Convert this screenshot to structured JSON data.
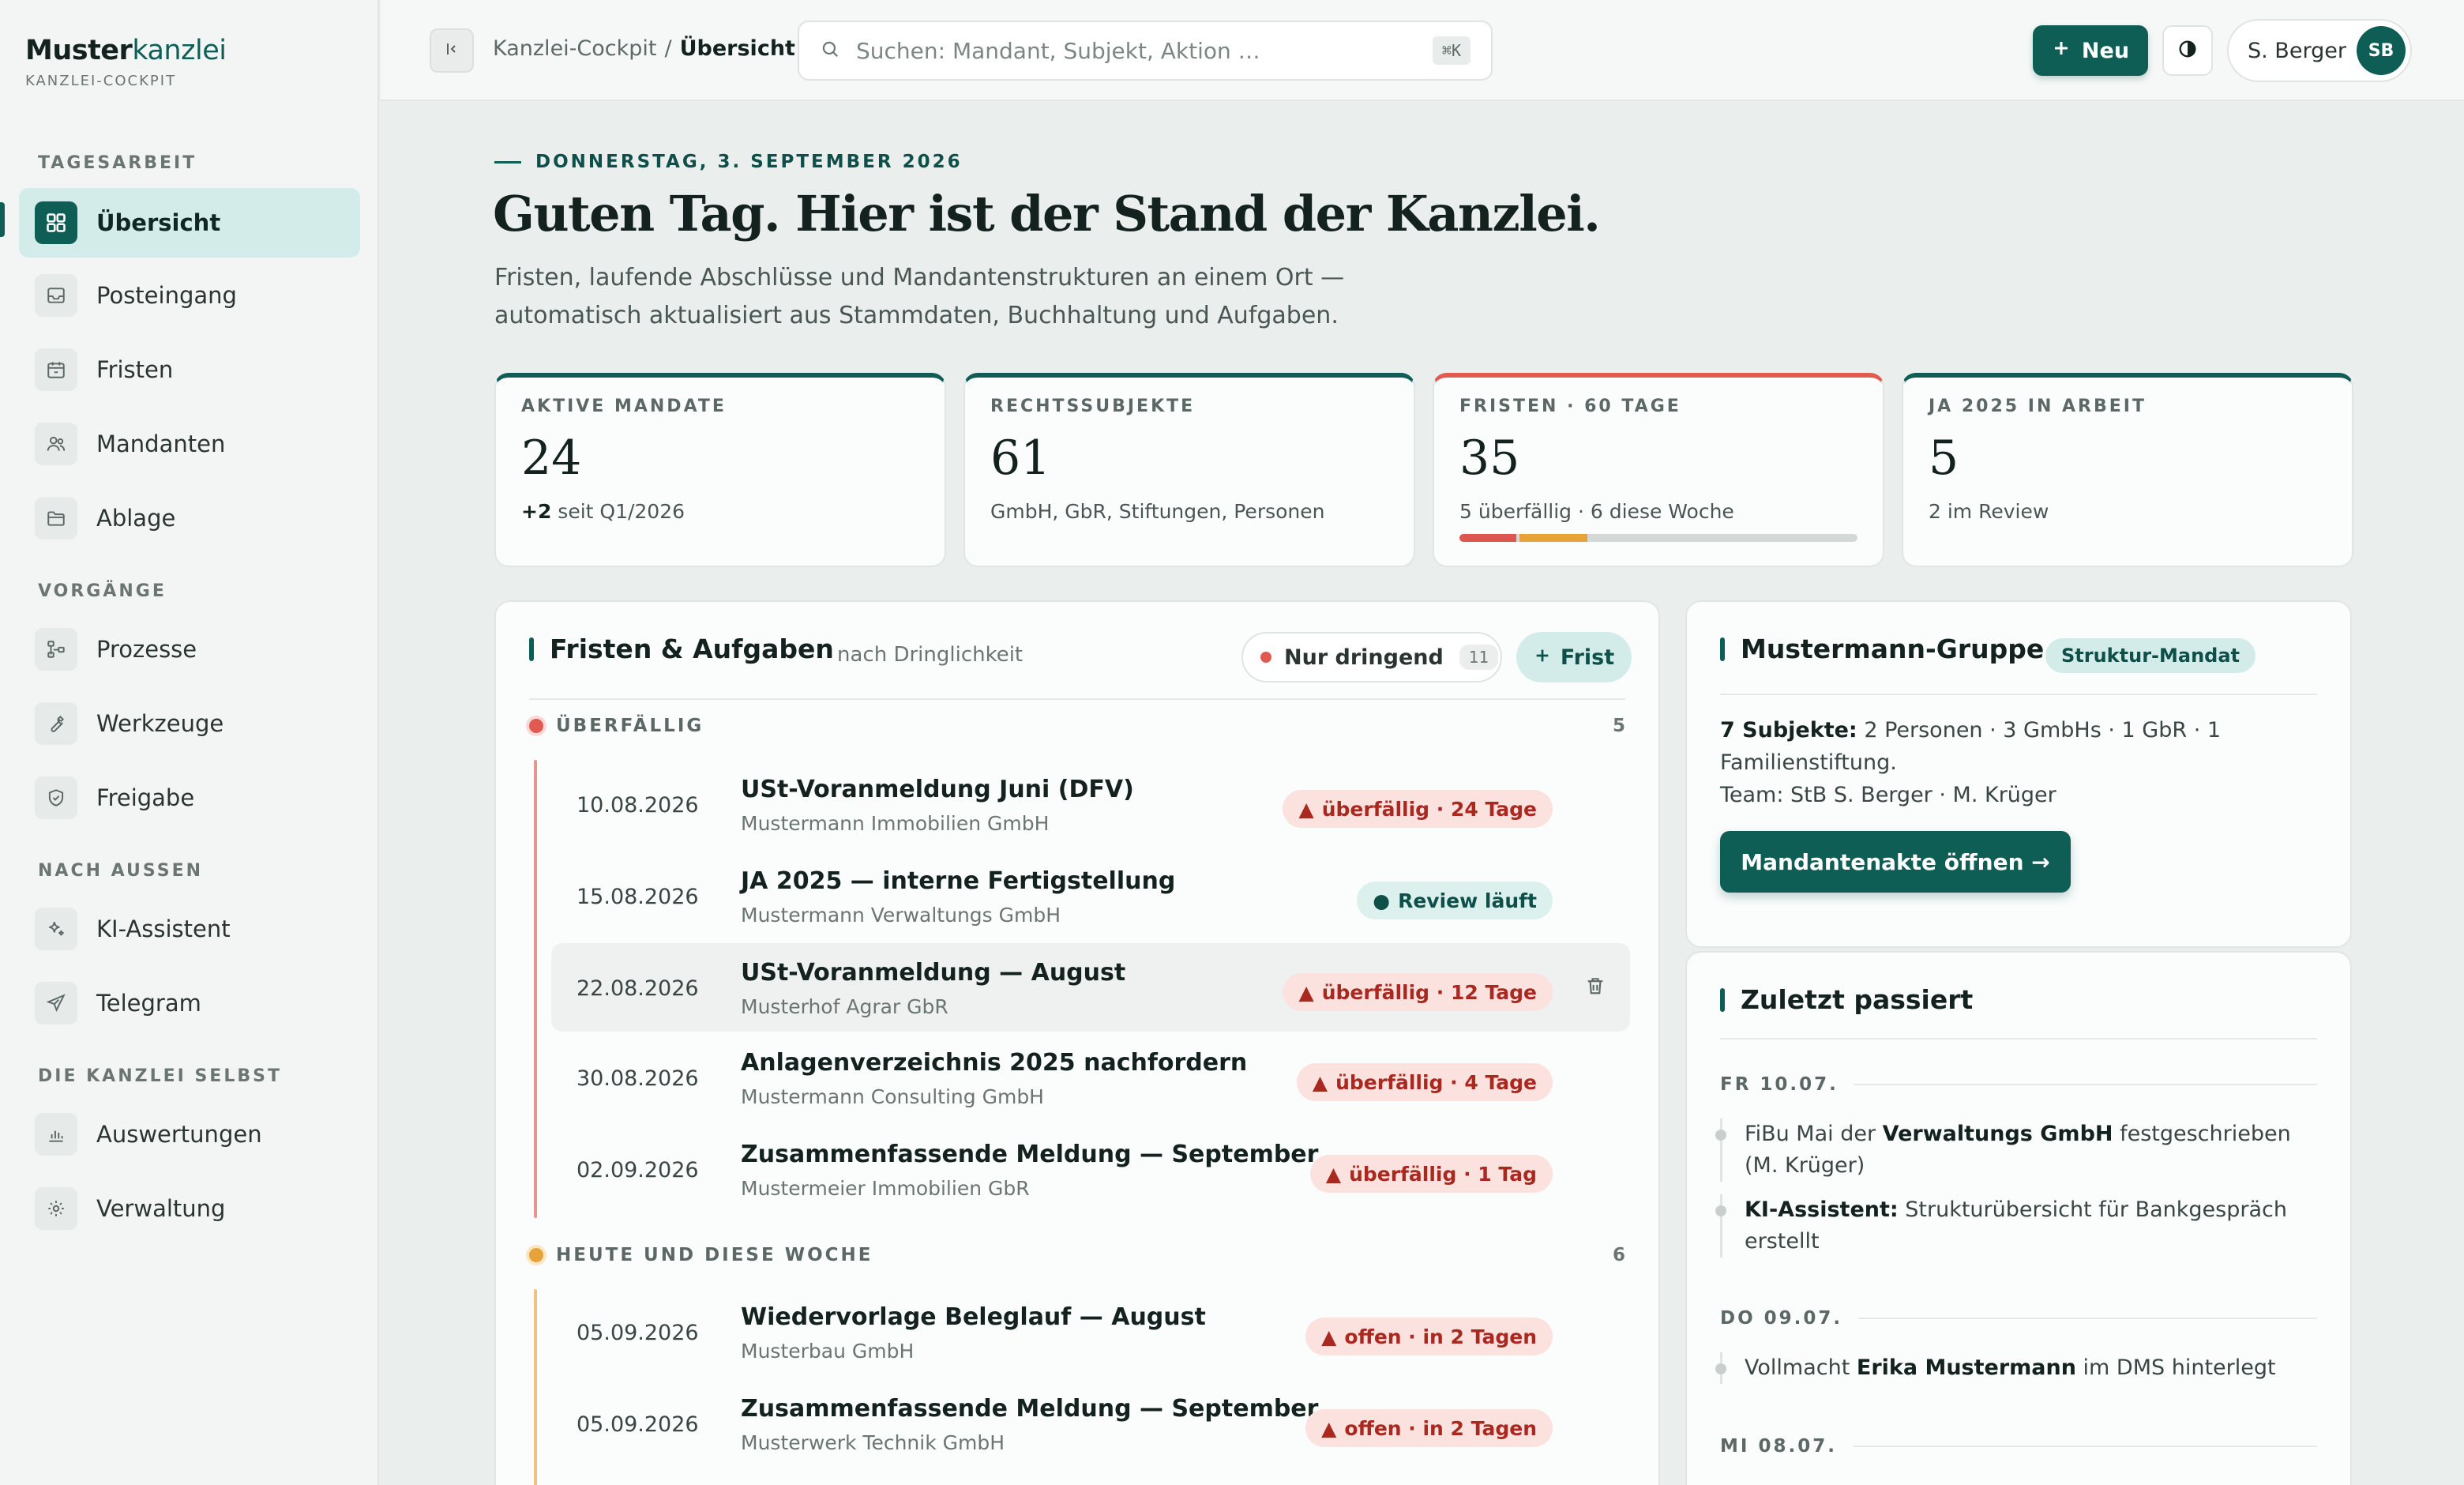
{
  "sidebar": {
    "brand": {
      "strong": "Muster",
      "accent": "kanzlei",
      "subtitle": "KANZLEI-COCKPIT"
    },
    "sections": [
      {
        "title": "TAGESARBEIT",
        "items": [
          {
            "label": "Übersicht",
            "icon": "grid-icon",
            "active": true
          },
          {
            "label": "Posteingang",
            "icon": "inbox-icon"
          },
          {
            "label": "Fristen",
            "icon": "calendar-icon"
          },
          {
            "label": "Mandanten",
            "icon": "users-icon"
          },
          {
            "label": "Ablage",
            "icon": "folder-icon"
          }
        ]
      },
      {
        "title": "VORGÄNGE",
        "items": [
          {
            "label": "Prozesse",
            "icon": "flow-icon"
          },
          {
            "label": "Werkzeuge",
            "icon": "wrench-icon"
          },
          {
            "label": "Freigabe",
            "icon": "shield-check-icon"
          }
        ]
      },
      {
        "title": "NACH AUSSEN",
        "items": [
          {
            "label": "KI-Assistent",
            "icon": "sparkle-icon"
          },
          {
            "label": "Telegram",
            "icon": "send-icon"
          }
        ]
      },
      {
        "title": "DIE KANZLEI SELBST",
        "items": [
          {
            "label": "Auswertungen",
            "icon": "bar-chart-icon"
          },
          {
            "label": "Verwaltung",
            "icon": "gear-icon"
          }
        ]
      }
    ]
  },
  "topbar": {
    "breadcrumb": {
      "parent": "Kanzlei-Cockpit",
      "separator": "/",
      "current": "Übersicht"
    },
    "search": {
      "placeholder": "Suchen: Mandant, Subjekt, Aktion …",
      "shortcut": "⌘K"
    },
    "new_label": "Neu",
    "user": {
      "name": "S. Berger",
      "initials": "SB"
    }
  },
  "hero": {
    "date": "DONNERSTAG, 3. SEPTEMBER 2026",
    "headline": "Guten Tag. Hier ist der Stand der Kanzlei.",
    "intro_line1": "Fristen, laufende Abschlüsse und Mandantenstrukturen an einem Ort —",
    "intro_line2": "automatisch aktualisiert aus Stammdaten, Buchhaltung und Aufgaben."
  },
  "kpis": [
    {
      "label": "AKTIVE MANDATE",
      "value": "24",
      "sub_bold": "+2",
      "sub": "seit Q1/2026"
    },
    {
      "label": "RECHTSSUBJEKTE",
      "value": "61",
      "sub_bold": "",
      "sub": "GmbH, GbR, Stiftungen, Personen"
    },
    {
      "label": "FRISTEN · 60 TAGE",
      "value": "35",
      "sub_bold": "",
      "sub": "5 überfällig · 6 diese Woche",
      "bar": {
        "overdue": 5,
        "this_week": 6,
        "total": 35
      }
    },
    {
      "label": "JA 2025 IN ARBEIT",
      "value": "5",
      "sub_bold": "",
      "sub": "2 im Review"
    }
  ],
  "tasks": {
    "title": "Fristen & Aufgaben",
    "subtitle": "nach Dringlichkeit",
    "filter": {
      "label": "Nur dringend",
      "count": "11"
    },
    "add_label": "Frist",
    "groups": [
      {
        "title": "ÜBERFÄLLIG",
        "count": "5",
        "rows": [
          {
            "date": "10.08.2026",
            "title": "USt-Voranmeldung Juni (DFV)",
            "client": "Mustermann Immobilien GmbH",
            "badge": "überfällig · 24 Tage",
            "tone": "red"
          },
          {
            "date": "15.08.2026",
            "title": "JA 2025 — interne Fertigstellung",
            "client": "Mustermann Verwaltungs GmbH",
            "badge": "Review läuft",
            "tone": "teal"
          },
          {
            "date": "22.08.2026",
            "title": "USt-Voranmeldung — August",
            "client": "Musterhof Agrar GbR",
            "badge": "überfällig · 12 Tage",
            "tone": "red"
          },
          {
            "date": "30.08.2026",
            "title": "Anlagenverzeichnis 2025 nachfordern",
            "client": "Mustermann Consulting GmbH",
            "badge": "überfällig · 4 Tage",
            "tone": "red"
          },
          {
            "date": "02.09.2026",
            "title": "Zusammenfassende Meldung — September",
            "client": "Mustermeier Immobilien GbR",
            "badge": "überfällig · 1 Tag",
            "tone": "red"
          }
        ]
      },
      {
        "title": "HEUTE UND DIESE WOCHE",
        "count": "6",
        "rows": [
          {
            "date": "05.09.2026",
            "title": "Wiedervorlage Beleglauf — August",
            "client": "Musterbau GmbH",
            "badge": "offen · in 2 Tagen",
            "tone": "red"
          },
          {
            "date": "05.09.2026",
            "title": "Zusammenfassende Meldung — September",
            "client": "Musterwerk Technik GmbH",
            "badge": "offen · in 2 Tagen",
            "tone": "red"
          }
        ]
      }
    ]
  },
  "group_card": {
    "title": "Mustermann-Gruppe",
    "badge": "Struktur-Mandat",
    "subjects_label": "7 Subjekte:",
    "subjects": "2 Personen · 3 GmbHs · 1 GbR · 1 Familienstiftung.",
    "team": "Team: StB S. Berger · M. Krüger",
    "button": "Mandantenakte öffnen →"
  },
  "recent": {
    "title": "Zuletzt passiert",
    "days": [
      {
        "label": "FR 10.07."
      },
      {
        "label": "DO 09.07."
      },
      {
        "label": "MI 08.07."
      }
    ],
    "events": [
      {
        "pre": "FiBu Mai der ",
        "bold": "Verwaltungs GmbH",
        "post": " festgeschrieben (M. Krüger)"
      },
      {
        "pre": "",
        "bold": "KI-Assistent:",
        "post": " Strukturübersicht für Bankgespräch erstellt"
      },
      {
        "pre": "Vollmacht ",
        "bold": "Erika Mustermann",
        "post": " im DMS hinterlegt"
      }
    ]
  },
  "colors": {
    "brand": "#0f5e56",
    "overdue": "#e05a52",
    "week": "#e7a23a",
    "page": "#eaeeec"
  }
}
